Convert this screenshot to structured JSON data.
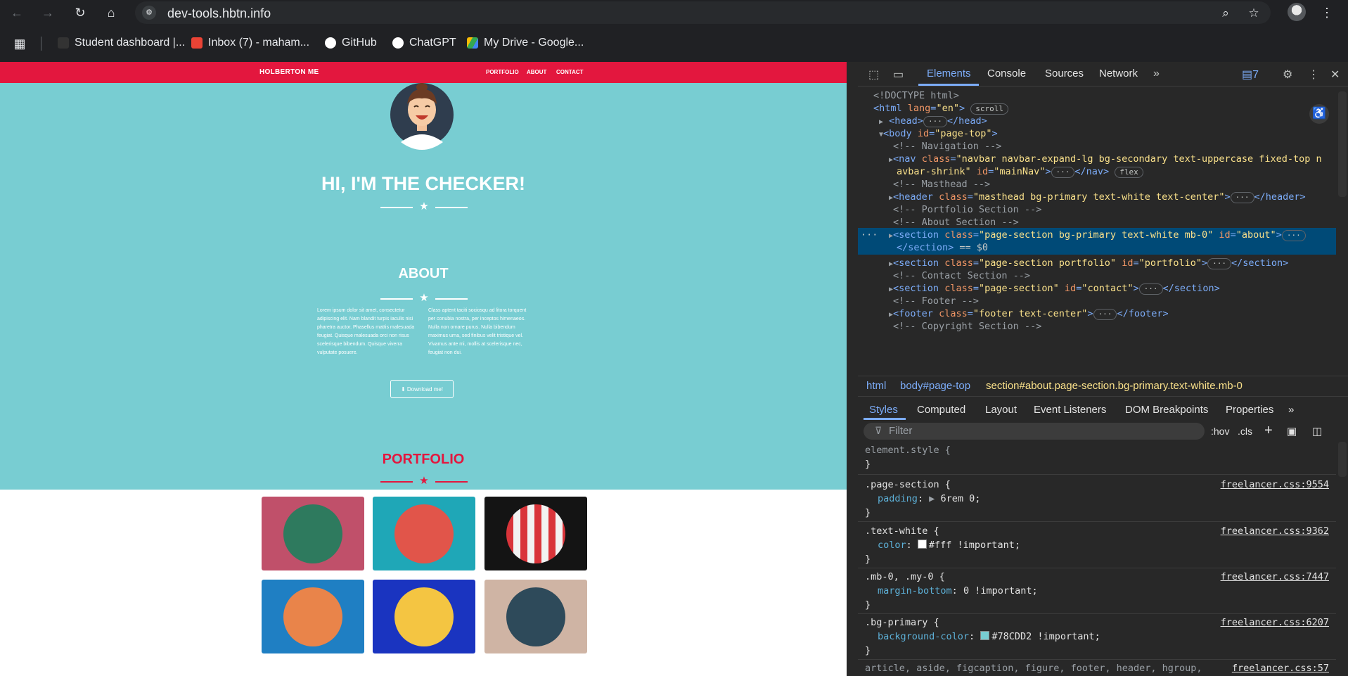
{
  "browser": {
    "url": "dev-tools.hbtn.info",
    "bookmarks": [
      {
        "label": "Student dashboard |...",
        "color": "#202124"
      },
      {
        "label": "Inbox (7) - maham...",
        "color": "#ea4335"
      },
      {
        "label": "GitHub",
        "color": "#ffffff"
      },
      {
        "label": "ChatGPT",
        "color": "#ffffff"
      },
      {
        "label": "My Drive - Google...",
        "color": "#34a853"
      }
    ]
  },
  "site": {
    "brand": "HOLBERTON ME",
    "nav": [
      "PORTFOLIO",
      "ABOUT",
      "CONTACT"
    ],
    "hero_title": "HI, I'M THE CHECKER!",
    "about_title": "ABOUT",
    "about_col1": "Lorem ipsum dolor sit amet, consectetur adipiscing elit. Nam blandit turpis iaculis nisi pharetra auctor. Phasellus mattis malesuada feugiat. Quisque malesuada orci non risus scelerisque bibendum. Quisque viverra vulputate posuere.",
    "about_col2": "Class aptent taciti sociosqu ad litora torquent per conubia nostra, per inceptos himenaeos. Nulla non ornare purus. Nulla bibendum maximus urna, sed finibus velit tristique vel. Vivamus ante mi, mollis at scelerisque nec, feugiat non dui.",
    "download_label": "Download me!",
    "portfolio_title": "PORTFOLIO",
    "colors": {
      "primary": "#78CDD2",
      "secondary": "#e3173e"
    },
    "tiles": [
      {
        "name": "cabin",
        "bg": "#c0506a",
        "circle": "#2e7a5e"
      },
      {
        "name": "cake",
        "bg": "#1fa7b7",
        "circle": "#e1554a"
      },
      {
        "name": "circus",
        "bg": "#141414",
        "circle": "#e8e8e8"
      },
      {
        "name": "game",
        "bg": "#1f7fc3",
        "circle": "#e9844a"
      },
      {
        "name": "safe",
        "bg": "#1a34c0",
        "circle": "#f4c542"
      },
      {
        "name": "submarine",
        "bg": "#cfb4a4",
        "circle": "#2e4a5a"
      }
    ]
  },
  "devtools": {
    "tabs": [
      "Elements",
      "Console",
      "Sources",
      "Network"
    ],
    "issues": "7",
    "dom": {
      "doctype": "<!DOCTYPE html>",
      "html_open": "<html",
      "html_lang_attr": "lang",
      "html_lang_val": "\"en\"",
      "scroll_pill": "scroll",
      "head": "<head>",
      "head_close": "</head>",
      "body_open": "<body",
      "body_id_attr": "id",
      "body_id_val": "\"page-top\"",
      "cmt_nav": "<!-- Navigation -->",
      "nav_tag": "<nav",
      "nav_class_attr": "class",
      "nav_class_val1": "\"navbar navbar-expand-lg bg-secondary text-uppercase fixed-top n",
      "nav_class_val2": "avbar-shrink\"",
      "nav_id_attr": "id",
      "nav_id_val": "\"mainNav\"",
      "nav_close": "</nav>",
      "flex_pill": "flex",
      "cmt_masthead": "<!-- Masthead -->",
      "header_tag": "<header",
      "header_class_attr": "class",
      "header_class_val": "\"masthead bg-primary text-white text-center\"",
      "header_close": "</header>",
      "cmt_portfolio": "<!-- Portfolio Section -->",
      "cmt_about": "<!-- About Section -->",
      "sel_tag": "<section",
      "sel_class_attr": "class",
      "sel_class_val": "\"page-section bg-primary text-white mb-0\"",
      "sel_id_attr": "id",
      "sel_id_val": "\"about\"",
      "sel_close": "</section>",
      "sel_eq": "== $0",
      "sec2_class_val": "\"page-section portfolio\"",
      "sec2_id_val": "\"portfolio\"",
      "cmt_contact": "<!-- Contact Section -->",
      "sec3_class_val": "\"page-section\"",
      "sec3_id_val": "\"contact\"",
      "cmt_footer": "<!-- Footer -->",
      "footer_tag": "<footer",
      "footer_class_val": "\"footer text-center\"",
      "footer_close": "</footer>",
      "cmt_copyright": "<!-- Copyright Section -->"
    },
    "breadcrumbs": [
      "html",
      "body#page-top",
      "section#about.page-section.bg-primary.text-white.mb-0"
    ],
    "style_tabs": [
      "Styles",
      "Computed",
      "Layout",
      "Event Listeners",
      "DOM Breakpoints",
      "Properties"
    ],
    "filter_placeholder": "Filter",
    "hov": ":hov",
    "cls": ".cls",
    "rules": [
      {
        "selector": "element.style {",
        "prop": "",
        "value": "",
        "source": ""
      },
      {
        "selector": ".page-section {",
        "prop": "padding",
        "value": "6rem 0;",
        "source": "freelancer.css:9554"
      },
      {
        "selector": ".text-white {",
        "prop": "color",
        "value": "#fff !important;",
        "source": "freelancer.css:9362"
      },
      {
        "selector": ".mb-0, .my-0 {",
        "prop": "margin-bottom",
        "value": "0 !important;",
        "source": "freelancer.css:7447"
      },
      {
        "selector": ".bg-primary {",
        "prop": "background-color",
        "value": "#78CDD2 !important;",
        "source": "freelancer.css:6207"
      },
      {
        "selector": "article, aside, figcaption, figure, footer, header, hgroup,",
        "prop": "",
        "value": "",
        "source": "freelancer.css:57"
      }
    ],
    "close_brace": "}"
  }
}
